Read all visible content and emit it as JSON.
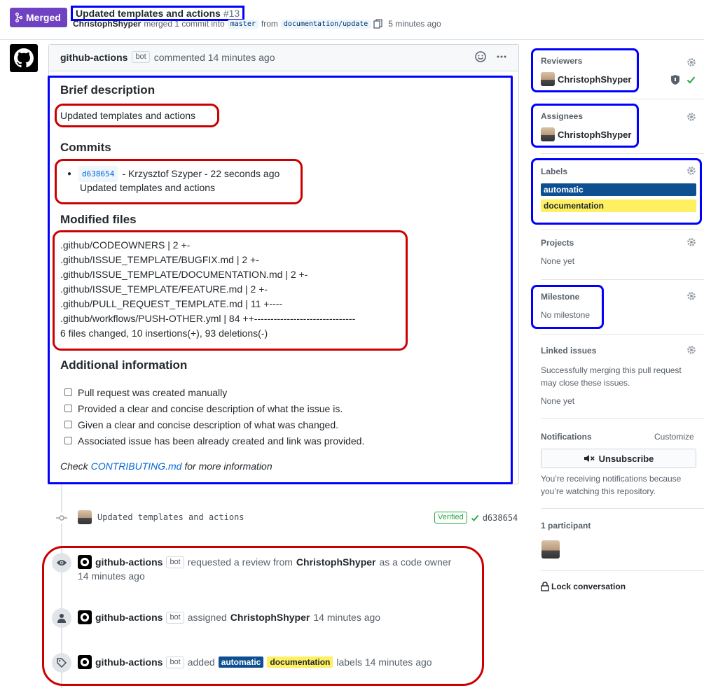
{
  "header": {
    "status": "Merged",
    "title": "Updated templates and actions",
    "number": "#13",
    "author": "ChristophShyper",
    "merge_text": "merged 1 commit into",
    "base_branch": "master",
    "from_text": "from",
    "head_branch": "documentation/update",
    "time": "5 minutes ago"
  },
  "comment": {
    "author": "github-actions",
    "bot_label": "bot",
    "action": "commented 14 minutes ago",
    "brief_heading": "Brief description",
    "brief_text": "Updated templates and actions",
    "commits_heading": "Commits",
    "commit_sha": "d638654",
    "commit_meta": "- Krzysztof Szyper - 22 seconds ago",
    "commit_message": "Updated templates and actions",
    "files_heading": "Modified files",
    "files": [
      ".github/CODEOWNERS | 2 +-",
      ".github/ISSUE_TEMPLATE/BUGFIX.md | 2 +-",
      ".github/ISSUE_TEMPLATE/DOCUMENTATION.md | 2 +-",
      ".github/ISSUE_TEMPLATE/FEATURE.md | 2 +-",
      ".github/PULL_REQUEST_TEMPLATE.md | 11 +----",
      ".github/workflows/PUSH-OTHER.yml | 84 ++-------------------------------",
      "6 files changed, 10 insertions(+), 93 deletions(-)"
    ],
    "additional_heading": "Additional information",
    "checklist": [
      "Pull request was created manually",
      "Provided a clear and concise description of what the issue is.",
      "Given a clear and concise description of what was changed.",
      "Associated issue has been already created and link was provided."
    ],
    "footer_prefix": "Check ",
    "footer_link": "CONTRIBUTING.md",
    "footer_suffix": " for more information"
  },
  "timeline": {
    "commit_message": "Updated templates and actions",
    "verified": "Verified",
    "commit_sha": "d638654",
    "review_event": {
      "actor": "github-actions",
      "bot": "bot",
      "text": "requested a review from",
      "target": "ChristophShyper",
      "suffix": "as a code owner",
      "time": "14 minutes ago"
    },
    "assign_event": {
      "actor": "github-actions",
      "bot": "bot",
      "text": "assigned",
      "target": "ChristophShyper",
      "time": "14 minutes ago"
    },
    "label_event": {
      "actor": "github-actions",
      "bot": "bot",
      "text": "added",
      "label1": "automatic",
      "label2": "documentation",
      "suffix": "labels 14 minutes ago"
    }
  },
  "sidebar": {
    "reviewers_title": "Reviewers",
    "reviewer": "ChristophShyper",
    "assignees_title": "Assignees",
    "assignee": "ChristophShyper",
    "labels_title": "Labels",
    "label1": "automatic",
    "label2": "documentation",
    "projects_title": "Projects",
    "projects_value": "None yet",
    "milestone_title": "Milestone",
    "milestone_value": "No milestone",
    "linked_title": "Linked issues",
    "linked_desc1": "Successfully merging this pull request",
    "linked_desc2": "may close these issues.",
    "linked_value": "None yet",
    "notifications_title": "Notifications",
    "customize": "Customize",
    "unsubscribe": "Unsubscribe",
    "notif_desc1": "You’re receiving notifications because",
    "notif_desc2": "you’re watching this repository.",
    "participants_title": "1 participant",
    "lock": "Lock conversation"
  },
  "colors": {
    "merged": "#6f42c1",
    "label_automatic": "#0e4f92",
    "label_documentation": "#fef061",
    "link": "#0366d6",
    "annotation_blue": "#0000ff",
    "annotation_red": "#cc0000"
  }
}
